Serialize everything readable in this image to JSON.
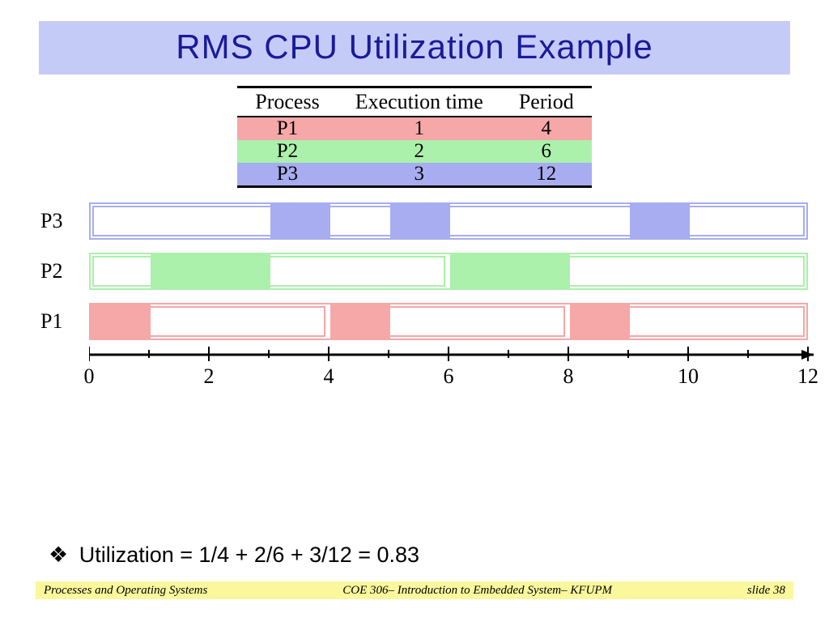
{
  "title": "RMS CPU Utilization Example",
  "table": {
    "columns": [
      "Process",
      "Execution time",
      "Period"
    ],
    "rows": [
      {
        "name": "P1",
        "exec": "1",
        "period": "4"
      },
      {
        "name": "P2",
        "exec": "2",
        "period": "6"
      },
      {
        "name": "P3",
        "exec": "3",
        "period": "12"
      }
    ]
  },
  "chart_data": {
    "type": "bar",
    "xlabel": "",
    "ylabel": "",
    "xlim": [
      0,
      12
    ],
    "ticks": [
      0,
      2,
      4,
      6,
      8,
      10,
      12
    ],
    "lanes": [
      {
        "name": "P3",
        "color": "#a7adf0",
        "segments": [
          [
            3,
            4
          ],
          [
            5,
            6
          ],
          [
            9,
            10
          ]
        ],
        "period_windows": [
          [
            0,
            12
          ]
        ]
      },
      {
        "name": "P2",
        "color": "#abf0ab",
        "segments": [
          [
            1,
            3
          ],
          [
            6,
            8
          ]
        ],
        "period_windows": [
          [
            0,
            6
          ],
          [
            6,
            12
          ]
        ]
      },
      {
        "name": "P1",
        "color": "#f6a7a7",
        "segments": [
          [
            0,
            1
          ],
          [
            4,
            5
          ],
          [
            8,
            9
          ]
        ],
        "period_windows": [
          [
            0,
            4
          ],
          [
            4,
            8
          ],
          [
            8,
            12
          ]
        ]
      }
    ]
  },
  "utilization_text": "Utilization = 1/4 + 2/6 + 3/12 = 0.83",
  "footer": {
    "left": "Processes and Operating Systems",
    "center": "COE 306– Introduction to Embedded System– KFUPM",
    "right": "slide 38"
  }
}
